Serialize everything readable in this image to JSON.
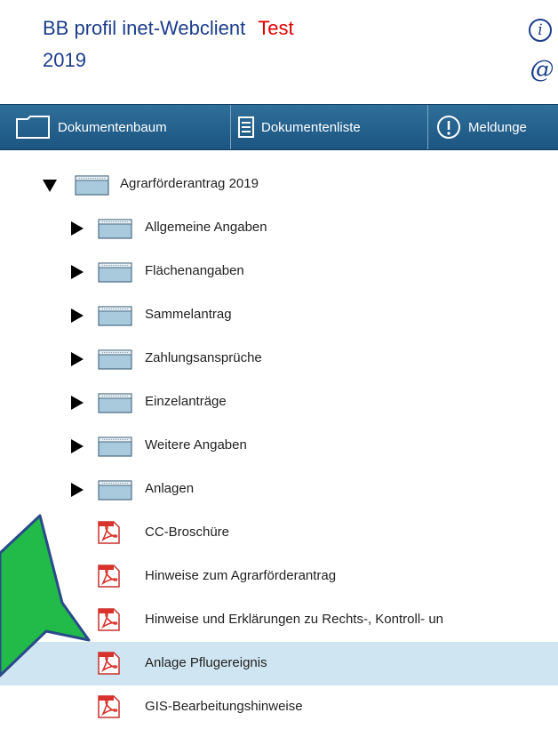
{
  "header": {
    "title": "BB profil inet-Webclient",
    "tag": "Test",
    "year": "2019",
    "info_icon_glyph": "i",
    "at_icon_glyph": "@"
  },
  "toolbar": {
    "document_tree": "Dokumentenbaum",
    "document_list": "Dokumentenliste",
    "messages": "Meldunge",
    "messages_icon_glyph": "!"
  },
  "tree": {
    "root": {
      "label": "Agrarförderantrag 2019",
      "icon": "folder-icon",
      "expanded": true
    },
    "folders": [
      {
        "label": "Allgemeine Angaben",
        "icon": "folder-icon"
      },
      {
        "label": "Flächenangaben",
        "icon": "folder-icon"
      },
      {
        "label": "Sammelantrag",
        "icon": "folder-icon"
      },
      {
        "label": "Zahlungsansprüche",
        "icon": "folder-icon"
      },
      {
        "label": "Einzelanträge",
        "icon": "folder-icon"
      },
      {
        "label": "Weitere Angaben",
        "icon": "folder-icon"
      },
      {
        "label": "Anlagen",
        "icon": "folder-icon"
      }
    ],
    "documents": [
      {
        "label": "CC-Broschüre",
        "icon": "pdf-icon",
        "selected": false
      },
      {
        "label": "Hinweise zum Agrarförderantrag",
        "icon": "pdf-icon",
        "selected": false
      },
      {
        "label": "Hinweise und Erklärungen zu Rechts-, Kontroll- un",
        "icon": "pdf-icon",
        "selected": false
      },
      {
        "label": "Anlage Pflugereignis",
        "icon": "pdf-icon",
        "selected": true
      },
      {
        "label": "GIS-Bearbeitungshinweise",
        "icon": "pdf-icon",
        "selected": false
      }
    ]
  },
  "colors": {
    "title": "#1b3d8a",
    "tag": "#e00000",
    "toolbar": "#245f8c",
    "selected_row": "#cfe6f2",
    "annotation_arrow": "#22bb4a"
  }
}
